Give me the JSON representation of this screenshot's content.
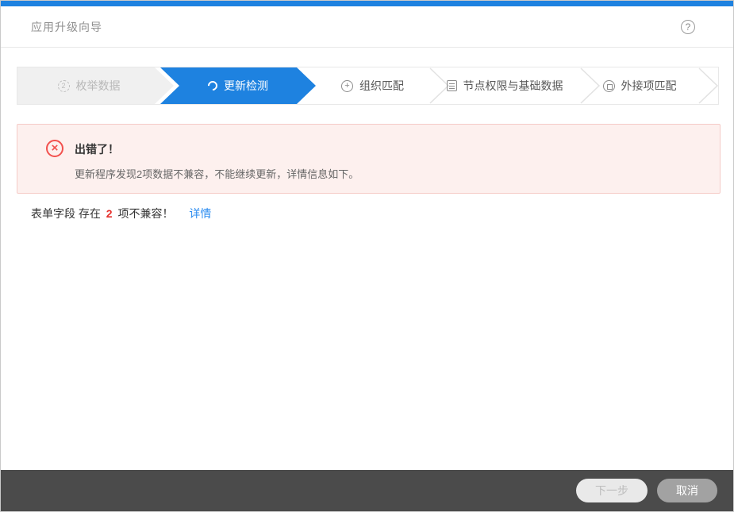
{
  "window": {
    "title": "应用升级向导"
  },
  "header": {
    "help_icon": "?"
  },
  "colors": {
    "accent_blue": "#1e82e0",
    "link_blue": "#2b8cf0",
    "error_red": "#f2504d",
    "error_bg": "#fdf0ee",
    "footer_bg": "#4b4b4b"
  },
  "stepper": {
    "steps": [
      {
        "label": "枚举数据",
        "icon": "enum-data-icon",
        "state": "disabled"
      },
      {
        "label": "更新检测",
        "icon": "refresh-icon",
        "state": "active"
      },
      {
        "label": "组织匹配",
        "icon": "org-match-icon",
        "state": "pending"
      },
      {
        "label": "节点权限与基础数据",
        "icon": "node-perms-icon",
        "state": "pending"
      },
      {
        "label": "外接项匹配",
        "icon": "external-match-icon",
        "state": "pending"
      }
    ]
  },
  "error_banner": {
    "icon": "error-circle-x-icon",
    "title": "出错了！",
    "message": "更新程序发现2项数据不兼容，不能继续更新，详情信息如下。"
  },
  "result_line": {
    "prefix": "表单字段 存在",
    "count": "2",
    "suffix": "项不兼容！",
    "link": "详情"
  },
  "footer": {
    "next_label": "下一步",
    "cancel_label": "取消"
  }
}
